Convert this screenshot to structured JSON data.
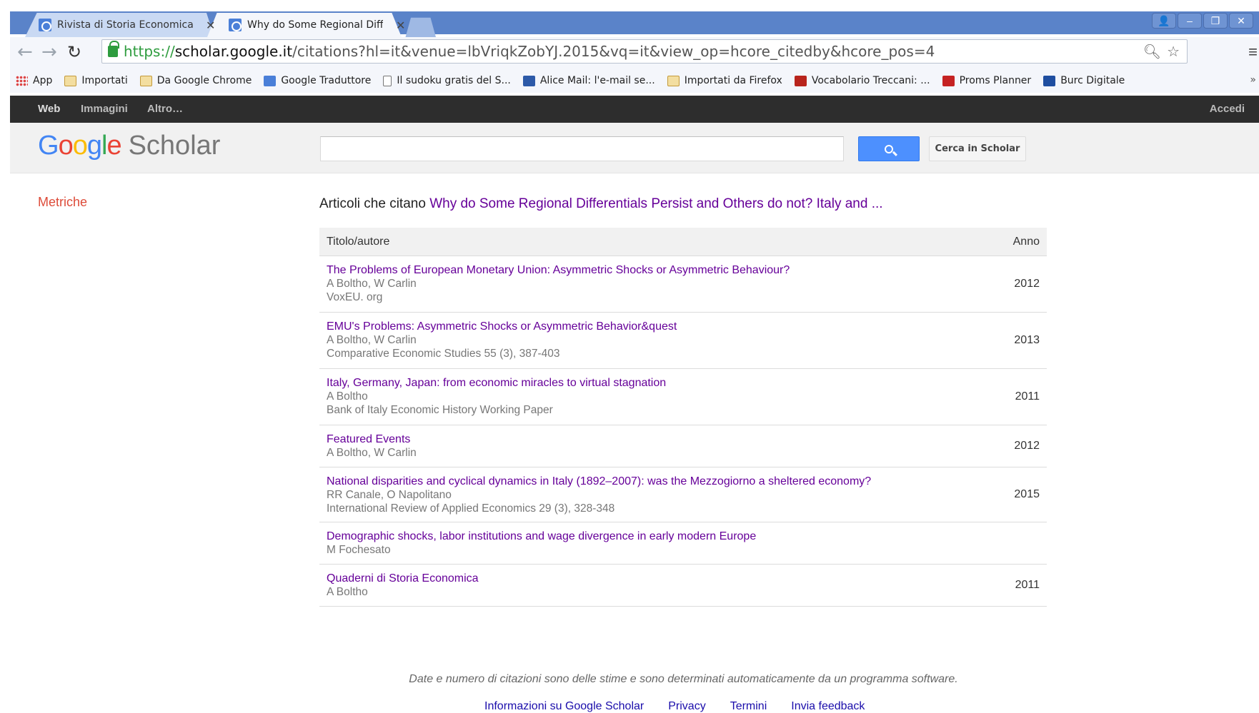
{
  "browser": {
    "tabs": [
      {
        "title": "Rivista di Storia Economica -",
        "active": false
      },
      {
        "title": "Why do Some Regional Diffe",
        "active": true
      }
    ],
    "url": {
      "scheme": "https://",
      "host": "scholar.google.it",
      "path": "/citations?hl=it&venue=lbVriqkZobYJ.2015&vq=it&view_op=hcore_citedby&hcore_pos=4"
    },
    "bookmarks": [
      {
        "label": "App",
        "icon": "apps-grid-icon"
      },
      {
        "label": "Importati",
        "icon": "folder-icon"
      },
      {
        "label": "Da Google Chrome",
        "icon": "folder-icon"
      },
      {
        "label": "Google Traduttore",
        "icon": "translate-icon"
      },
      {
        "label": "Il sudoku gratis del S...",
        "icon": "page-icon"
      },
      {
        "label": "Alice Mail: l'e-mail se...",
        "icon": "mail-icon"
      },
      {
        "label": "Importati da Firefox",
        "icon": "folder-icon"
      },
      {
        "label": "Vocabolario Treccani: ...",
        "icon": "treccani-icon"
      },
      {
        "label": "Proms Planner",
        "icon": "proms-icon"
      },
      {
        "label": "Burc Digitale",
        "icon": "burc-icon"
      }
    ],
    "more_bookmarks": "»"
  },
  "gbar": {
    "web": "Web",
    "images": "Immagini",
    "more": "Altro…",
    "signin": "Accedi"
  },
  "header": {
    "logo_scholar": "Scholar",
    "search_placeholder": "",
    "search_button_label": "Cerca in Scholar"
  },
  "sidebar": {
    "metrics_link": "Metriche"
  },
  "main": {
    "heading_prefix": "Articoli che citano",
    "cited_title": "Why do Some Regional Differentials Persist and Others do not? Italy and ...",
    "columns": {
      "title": "Titolo/autore",
      "year": "Anno"
    },
    "rows": [
      {
        "title": "The Problems of European Monetary Union: Asymmetric Shocks or Asymmetric Behaviour?",
        "authors": "A Boltho, W Carlin",
        "venue": "VoxEU. org",
        "year": "2012"
      },
      {
        "title": "EMU's Problems: Asymmetric Shocks or Asymmetric Behavior&quest",
        "authors": "A Boltho, W Carlin",
        "venue": "Comparative Economic Studies 55 (3), 387-403",
        "year": "2013"
      },
      {
        "title": "Italy, Germany, Japan: from economic miracles to virtual stagnation",
        "authors": "A Boltho",
        "venue": "Bank of Italy Economic History Working Paper",
        "year": "2011"
      },
      {
        "title": "Featured Events",
        "authors": "A Boltho, W Carlin",
        "venue": "",
        "year": "2012"
      },
      {
        "title": "National disparities and cyclical dynamics in Italy (1892–2007): was the Mezzogiorno a sheltered economy?",
        "authors": "RR Canale, O Napolitano",
        "venue": "International Review of Applied Economics 29 (3), 328-348",
        "year": "2015"
      },
      {
        "title": "Demographic shocks, labor institutions and wage divergence in early modern Europe",
        "authors": "M Fochesato",
        "venue": "",
        "year": ""
      },
      {
        "title": "Quaderni di Storia Economica",
        "authors": "A Boltho",
        "venue": "",
        "year": "2011"
      }
    ]
  },
  "footer": {
    "note": "Date e numero di citazioni sono delle stime e sono determinati automaticamente da un programma software.",
    "links": [
      "Informazioni su Google Scholar",
      "Privacy",
      "Termini",
      "Invia feedback"
    ]
  }
}
